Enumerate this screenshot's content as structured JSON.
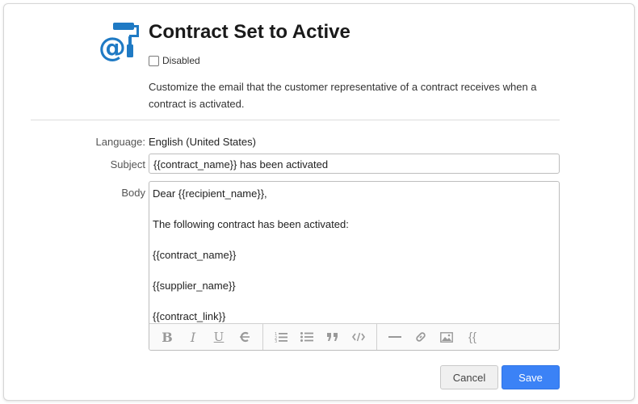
{
  "header": {
    "title": "Contract Set to Active",
    "disabled_label": "Disabled",
    "disabled_checked": false,
    "description": "Customize the email that the customer representative of a contract receives when a contract is activated.",
    "icon": "email-brush-icon"
  },
  "form": {
    "language_label": "Language:",
    "language_value": "English (United States)",
    "subject_label": "Subject",
    "subject_value": "{{contract_name}} has been activated",
    "body_label": "Body",
    "body_lines": [
      "Dear {{recipient_name}},",
      "",
      "The following contract has been activated:",
      "",
      "{{contract_name}}",
      "",
      "{{supplier_name}}",
      "",
      "{{contract_link}}"
    ]
  },
  "toolbar": {
    "bold": "B",
    "italic": "I",
    "underline": "U",
    "variable": "{{",
    "icons": [
      "bold-icon",
      "italic-icon",
      "underline-icon",
      "strikethrough-icon",
      "ordered-list-icon",
      "bullet-list-icon",
      "blockquote-icon",
      "code-icon",
      "horizontal-rule-icon",
      "link-icon",
      "image-icon",
      "variable-icon"
    ]
  },
  "actions": {
    "cancel_label": "Cancel",
    "save_label": "Save"
  },
  "colors": {
    "accent": "#3b82f6",
    "icon_blue": "#1f7ac4"
  }
}
